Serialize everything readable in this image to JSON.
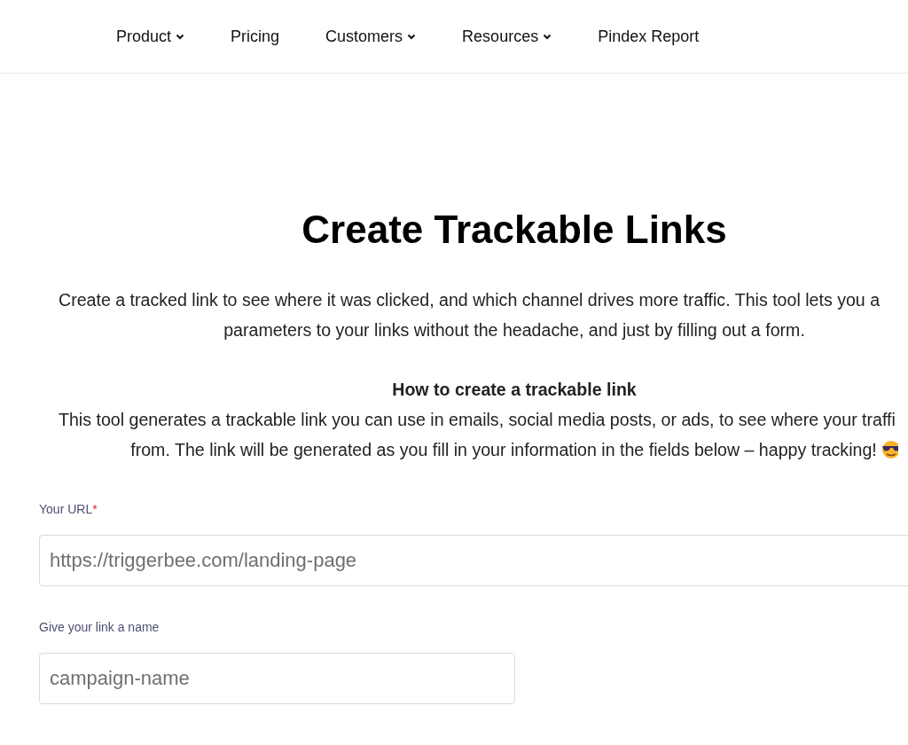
{
  "nav": [
    {
      "label": "Product",
      "dropdown": true
    },
    {
      "label": "Pricing",
      "dropdown": false
    },
    {
      "label": "Customers",
      "dropdown": true
    },
    {
      "label": "Resources",
      "dropdown": true
    },
    {
      "label": "Pindex Report",
      "dropdown": false
    }
  ],
  "title": "Create Trackable Links",
  "intro": [
    {
      "text": "Create a tracked link to see where it was clicked, and which channel drives more traffic. This tool lets you a",
      "cut": true
    },
    {
      "text": "parameters to your links without the headache, and just by filling out a form.",
      "cut": false
    }
  ],
  "howto": {
    "heading": "How to create a trackable link",
    "lines": [
      {
        "text": "This tool generates a trackable link you can use in emails, social media posts, or ads, to see where your traffi",
        "cut": true
      },
      {
        "text": "from. The link will be generated as you fill in your information in the fields below – happy tracking!",
        "cut": false
      }
    ]
  },
  "fields": [
    {
      "label": "Your URL",
      "required_mark": "*",
      "placeholder": "https://triggerbee.com/landing-page"
    },
    {
      "label": "Give your link a name",
      "placeholder": "campaign-name"
    }
  ]
}
